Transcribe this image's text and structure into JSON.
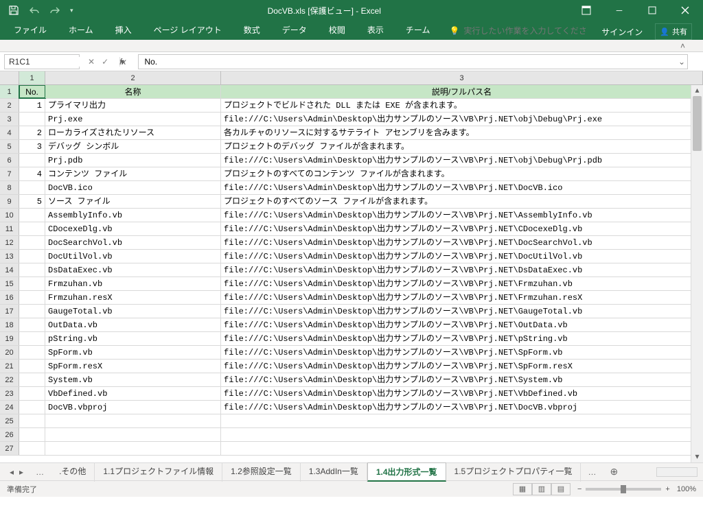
{
  "title": "DocVB.xls  [保護ビュー] - Excel",
  "ribbon": {
    "tabs": [
      "ファイル",
      "ホーム",
      "挿入",
      "ページ レイアウト",
      "数式",
      "データ",
      "校閲",
      "表示",
      "チーム"
    ],
    "tell_me": "実行したい作業を入力してください",
    "sign_in": "サインイン",
    "share": "共有"
  },
  "formula": {
    "name_box": "R1C1",
    "value": "No."
  },
  "col_headers": [
    "1",
    "2",
    "3"
  ],
  "header_row": [
    "No.",
    "名称",
    "説明/フルパス名"
  ],
  "rows": [
    {
      "a": "1",
      "b": "プライマリ出力",
      "c": "プロジェクトでビルドされた DLL または EXE が含まれます。"
    },
    {
      "a": "",
      "b": "Prj.exe",
      "c": "file:///C:\\Users\\Admin\\Desktop\\出力サンプルのソース\\VB\\Prj.NET\\obj\\Debug\\Prj.exe"
    },
    {
      "a": "2",
      "b": "ローカライズされたリソース",
      "c": "各カルチャのリソースに対するサテライト アセンブリを含みます。"
    },
    {
      "a": "3",
      "b": "デバッグ シンボル",
      "c": "プロジェクトのデバッグ ファイルが含まれます。"
    },
    {
      "a": "",
      "b": "Prj.pdb",
      "c": "file:///C:\\Users\\Admin\\Desktop\\出力サンプルのソース\\VB\\Prj.NET\\obj\\Debug\\Prj.pdb"
    },
    {
      "a": "4",
      "b": "コンテンツ ファイル",
      "c": "プロジェクトのすべてのコンテンツ ファイルが含まれます。"
    },
    {
      "a": "",
      "b": "DocVB.ico",
      "c": "file:///C:\\Users\\Admin\\Desktop\\出力サンプルのソース\\VB\\Prj.NET\\DocVB.ico"
    },
    {
      "a": "5",
      "b": "ソース ファイル",
      "c": "プロジェクトのすべてのソース ファイルが含まれます。"
    },
    {
      "a": "",
      "b": "AssemblyInfo.vb",
      "c": "file:///C:\\Users\\Admin\\Desktop\\出力サンプルのソース\\VB\\Prj.NET\\AssemblyInfo.vb"
    },
    {
      "a": "",
      "b": "CDocexeDlg.vb",
      "c": "file:///C:\\Users\\Admin\\Desktop\\出力サンプルのソース\\VB\\Prj.NET\\CDocexeDlg.vb"
    },
    {
      "a": "",
      "b": "DocSearchVol.vb",
      "c": "file:///C:\\Users\\Admin\\Desktop\\出力サンプルのソース\\VB\\Prj.NET\\DocSearchVol.vb"
    },
    {
      "a": "",
      "b": "DocUtilVol.vb",
      "c": "file:///C:\\Users\\Admin\\Desktop\\出力サンプルのソース\\VB\\Prj.NET\\DocUtilVol.vb"
    },
    {
      "a": "",
      "b": "DsDataExec.vb",
      "c": "file:///C:\\Users\\Admin\\Desktop\\出力サンプルのソース\\VB\\Prj.NET\\DsDataExec.vb"
    },
    {
      "a": "",
      "b": "Frmzuhan.vb",
      "c": "file:///C:\\Users\\Admin\\Desktop\\出力サンプルのソース\\VB\\Prj.NET\\Frmzuhan.vb"
    },
    {
      "a": "",
      "b": "Frmzuhan.resX",
      "c": "file:///C:\\Users\\Admin\\Desktop\\出力サンプルのソース\\VB\\Prj.NET\\Frmzuhan.resX"
    },
    {
      "a": "",
      "b": "GaugeTotal.vb",
      "c": "file:///C:\\Users\\Admin\\Desktop\\出力サンプルのソース\\VB\\Prj.NET\\GaugeTotal.vb"
    },
    {
      "a": "",
      "b": "OutData.vb",
      "c": "file:///C:\\Users\\Admin\\Desktop\\出力サンプルのソース\\VB\\Prj.NET\\OutData.vb"
    },
    {
      "a": "",
      "b": "pString.vb",
      "c": "file:///C:\\Users\\Admin\\Desktop\\出力サンプルのソース\\VB\\Prj.NET\\pString.vb"
    },
    {
      "a": "",
      "b": "SpForm.vb",
      "c": "file:///C:\\Users\\Admin\\Desktop\\出力サンプルのソース\\VB\\Prj.NET\\SpForm.vb"
    },
    {
      "a": "",
      "b": "SpForm.resX",
      "c": "file:///C:\\Users\\Admin\\Desktop\\出力サンプルのソース\\VB\\Prj.NET\\SpForm.resX"
    },
    {
      "a": "",
      "b": "System.vb",
      "c": "file:///C:\\Users\\Admin\\Desktop\\出力サンプルのソース\\VB\\Prj.NET\\System.vb"
    },
    {
      "a": "",
      "b": "VbDefined.vb",
      "c": "file:///C:\\Users\\Admin\\Desktop\\出力サンプルのソース\\VB\\Prj.NET\\VbDefined.vb"
    },
    {
      "a": "",
      "b": "DocVB.vbproj",
      "c": "file:///C:\\Users\\Admin\\Desktop\\出力サンプルのソース\\VB\\Prj.NET\\DocVB.vbproj"
    },
    {
      "a": "",
      "b": "",
      "c": ""
    },
    {
      "a": "",
      "b": "",
      "c": ""
    },
    {
      "a": "",
      "b": "",
      "c": ""
    }
  ],
  "sheet_tabs": {
    "list": [
      ".その他",
      "1.1プロジェクトファイル情報",
      "1.2参照設定一覧",
      "1.3AddIn一覧",
      "1.4出力形式一覧",
      "1.5プロジェクトプロパティ一覧"
    ],
    "active": 4
  },
  "status": {
    "ready": "準備完了",
    "zoom": "100%"
  }
}
